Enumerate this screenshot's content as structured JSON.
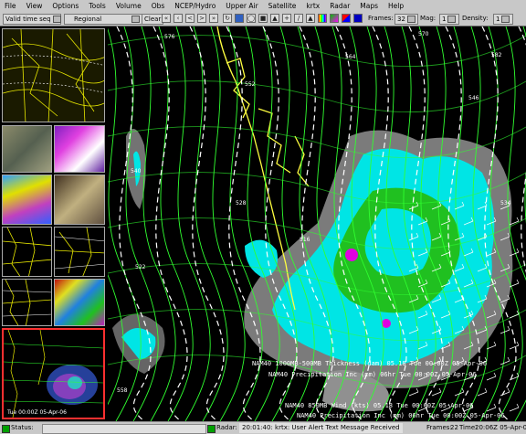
{
  "menu": [
    "File",
    "View",
    "Options",
    "Tools",
    "Volume",
    "Obs",
    "NCEP/Hydro",
    "Upper Air",
    "Satellite",
    "krtx",
    "Radar",
    "Maps",
    "Help"
  ],
  "toolbar": {
    "loop_mode": "Valid time seq",
    "scale": "Regional",
    "clear": "Clear",
    "frames_label": "Frames:",
    "frames_value": "32",
    "mag_label": "Mag:",
    "mag_value": "1",
    "density_label": "Density:",
    "density_value": "1",
    "icons": [
      "first-frame-icon",
      "prev-frame-icon",
      "step-back-icon",
      "step-forward-icon",
      "last-frame-icon",
      "loop-icon",
      "zoom-icon",
      "pan-icon",
      "sample-icon",
      "probe-icon",
      "crosshair-icon",
      "distance-icon",
      "time-height-icon",
      "rainbow-icon",
      "color-icon",
      "image-icon",
      "blend-icon"
    ]
  },
  "sidebar": {
    "thumb_caption": "Tue 00:00Z 05-Apr-06"
  },
  "main": {
    "contour_labels": [
      "576",
      "570",
      "564",
      "552",
      "546",
      "540",
      "534",
      "528",
      "522",
      "516",
      "558",
      "582"
    ],
    "legend": [
      {
        "text": "NAM40 1000MB-500MB Thickness (dam)  05.18  Tue 00:00Z 05-Apr-06",
        "color": "#ffffff"
      },
      {
        "text": "NAM40 Precipitation Inc (mm) 06hr  Tue 00:00Z 05-Apr-06",
        "color": "#ffffff"
      },
      {
        "text": "NAM40 850MB Wind (kts)  05.18  Tue 00:00Z 05-Apr-06",
        "color": "#ffffff"
      },
      {
        "text": "NAM40 Precipitation Inc (mm) 06hr  Tue 00:00Z 05-Apr-06",
        "color": "#ffffff"
      }
    ]
  },
  "status": {
    "label": "Status:",
    "radar_label": "Radar:",
    "message": "20:01:40: krtx: User Alert Text Message Received",
    "frames_label": "Frames:",
    "frames_value": "22",
    "time_label": "Time:",
    "time_value": "20:06Z 05-Apr-06"
  },
  "colors": {
    "panel_bg": "#c8c8c8",
    "contour_green": "#30ff30",
    "thickness_white": "#ffffff",
    "coast_yellow": "#ffff40",
    "precip_cyan": "#00e5e5",
    "precip_gray": "#909090",
    "precip_magenta": "#e000e0"
  }
}
